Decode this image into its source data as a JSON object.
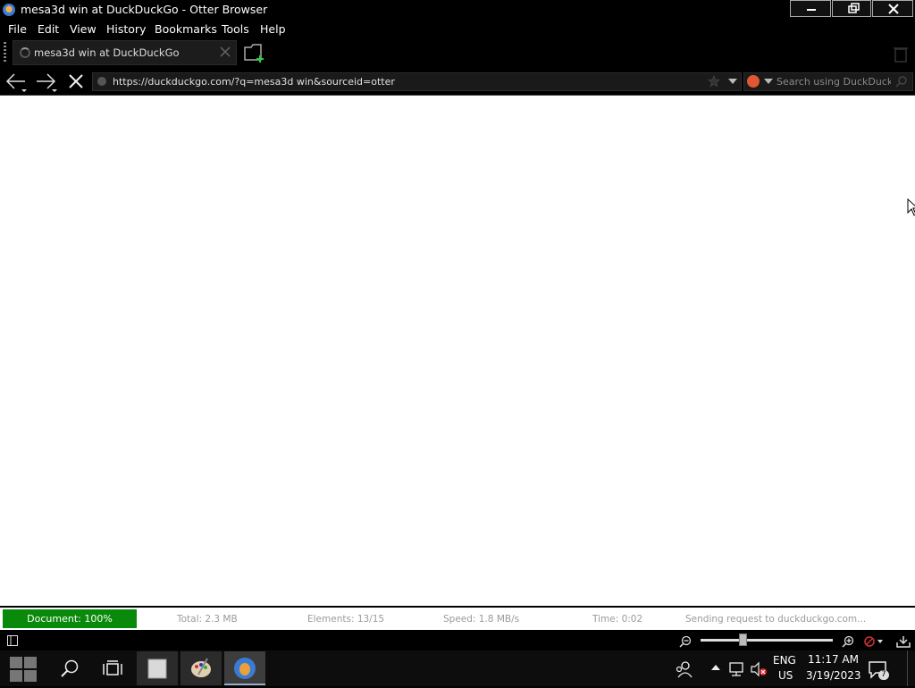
{
  "window": {
    "title": "mesa3d win at DuckDuckGo - Otter Browser",
    "app_icon": "otter-browser-icon",
    "controls": [
      "minimize-icon",
      "restore-icon",
      "close-icon"
    ]
  },
  "menubar": {
    "items": [
      "File",
      "Edit",
      "View",
      "History",
      "Bookmarks",
      "Tools",
      "Help"
    ]
  },
  "tabs": [
    {
      "title": "mesa3d win at DuckDuckGo",
      "loading": true,
      "icon": "loading-spinner-icon"
    }
  ],
  "navigation": {
    "address": "https://duckduckgo.com/?q=mesa3d win&sourceid=otter",
    "search_placeholder": "Search using DuckDuckGo",
    "search_engine_icon": "duckduckgo-icon"
  },
  "statusbar": {
    "progress_label": "Document: 100%",
    "progress_percent": 100,
    "total": "Total: 2.3 MB",
    "elements": "Elements: 13/15",
    "speed": "Speed: 1.8 MB/s",
    "time": "Time: 0:02",
    "message": "Sending request to duckduckgo.com...",
    "progress_color": "#0a8a0a"
  },
  "zoom": {
    "level_fraction": 0.32
  },
  "taskbar": {
    "apps": [
      "notepad-icon",
      "paint-icon",
      "otter-browser-icon"
    ],
    "language_line1": "ENG",
    "language_line2": "US",
    "time": "11:17 AM",
    "date": "3/19/2023",
    "notification_count": "7"
  }
}
